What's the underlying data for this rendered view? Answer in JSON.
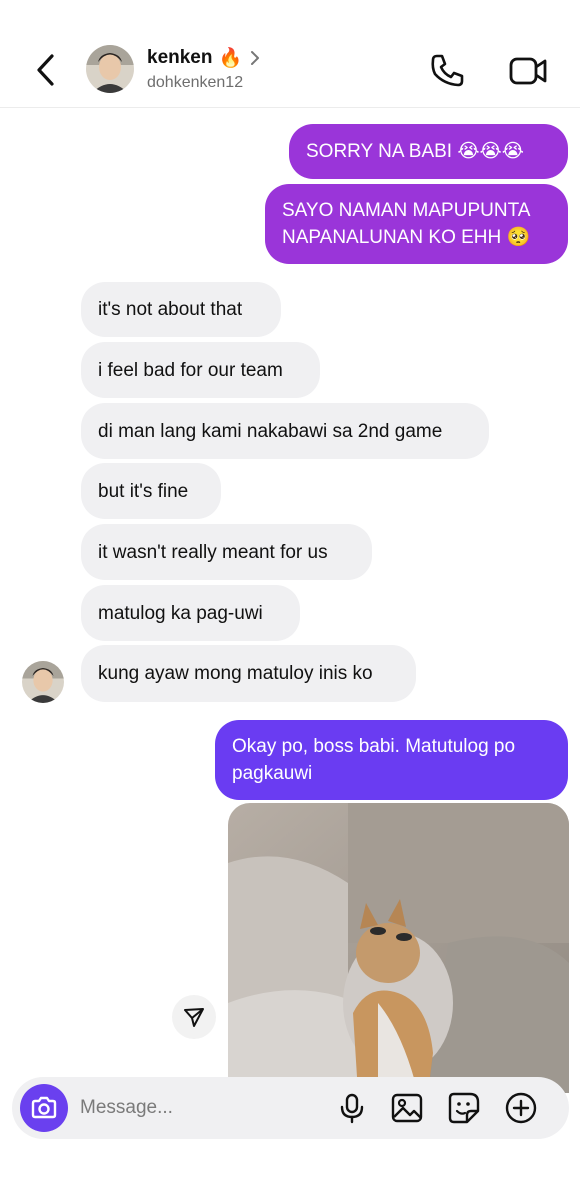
{
  "header": {
    "contact_name": "kenken",
    "name_emoji": "🔥",
    "username": "dohkenken12"
  },
  "messages": [
    {
      "side": "sent",
      "text": "SORRY NA BABI 😭😭😭"
    },
    {
      "side": "sent",
      "lines": [
        "SAYO NAMAN MAPUPUNTA",
        "NAPANALUNAN KO EHH 🥺"
      ]
    },
    {
      "side": "received",
      "text": "it's not about that"
    },
    {
      "side": "received",
      "text": "i feel bad for our team"
    },
    {
      "side": "received",
      "text": "di man lang kami nakabawi sa 2nd game"
    },
    {
      "side": "received",
      "text": "but it's fine"
    },
    {
      "side": "received",
      "text": "it wasn't really meant for us"
    },
    {
      "side": "received",
      "text": "matulog ka pag-uwi"
    },
    {
      "side": "received",
      "text": "kung ayaw mong matuloy inis ko"
    },
    {
      "side": "sent",
      "lines": [
        "Okay po, boss babi. Matutulog po",
        "pagkauwi"
      ]
    },
    {
      "side": "sent",
      "media": "animated-cat-gif"
    }
  ],
  "composer": {
    "placeholder": "Message..."
  },
  "icons": {
    "back": "chevron-left-icon",
    "call": "phone-icon",
    "video": "video-camera-icon",
    "camera": "camera-icon",
    "mic": "microphone-icon",
    "gallery": "image-icon",
    "sticker": "sticker-icon",
    "more": "plus-circle-icon",
    "share": "send-icon"
  },
  "colors": {
    "sent_purple": "#9a35d9",
    "sent_blue_purple": "#6a3cf2",
    "received_bg": "#f0f0f2",
    "camera_button": "#6a40ef"
  }
}
